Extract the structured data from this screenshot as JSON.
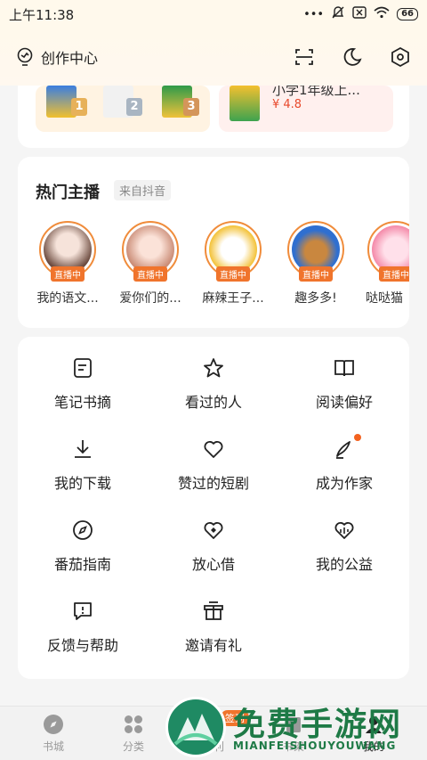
{
  "status_bar": {
    "time": "上午11:38",
    "battery": "66"
  },
  "header": {
    "creator_center": "创作中心"
  },
  "books": {
    "right_title_partial": "小学1年级上...",
    "right_price": "¥ 4.8",
    "ranks": [
      "1",
      "2",
      "3"
    ]
  },
  "hosts": {
    "title": "热门主播",
    "source": "来自抖音",
    "live_label": "直播中",
    "items": [
      {
        "name": "我的语文..."
      },
      {
        "name": "爱你们的..."
      },
      {
        "name": "麻辣王子..."
      },
      {
        "name": "趣多多!"
      },
      {
        "name": "哒哒猫"
      }
    ]
  },
  "menu": {
    "items": [
      {
        "label": "笔记书摘",
        "icon": "note-icon"
      },
      {
        "label": "看过的人",
        "icon": "star-icon"
      },
      {
        "label": "阅读偏好",
        "icon": "book-icon"
      },
      {
        "label": "我的下载",
        "icon": "download-icon"
      },
      {
        "label": "赞过的短剧",
        "icon": "heart-icon"
      },
      {
        "label": "成为作家",
        "icon": "pen-icon"
      },
      {
        "label": "番茄指南",
        "icon": "compass-icon"
      },
      {
        "label": "放心借",
        "icon": "heart-shield-icon"
      },
      {
        "label": "我的公益",
        "icon": "charity-icon"
      },
      {
        "label": "反馈与帮助",
        "icon": "feedback-icon"
      },
      {
        "label": "邀请有礼",
        "icon": "gift-icon"
      }
    ]
  },
  "bottom_nav": {
    "items": [
      {
        "label": "书城"
      },
      {
        "label": "分类"
      },
      {
        "label": "福利"
      },
      {
        "label": "书架"
      },
      {
        "label": "我的"
      }
    ],
    "checkin_badge": "签到"
  },
  "watermark": {
    "text": "免费手游网",
    "sub": "MIANFEISHOUYOUWANG"
  },
  "colors": {
    "accent": "#f0742c",
    "brand_green": "#1e7a46"
  }
}
